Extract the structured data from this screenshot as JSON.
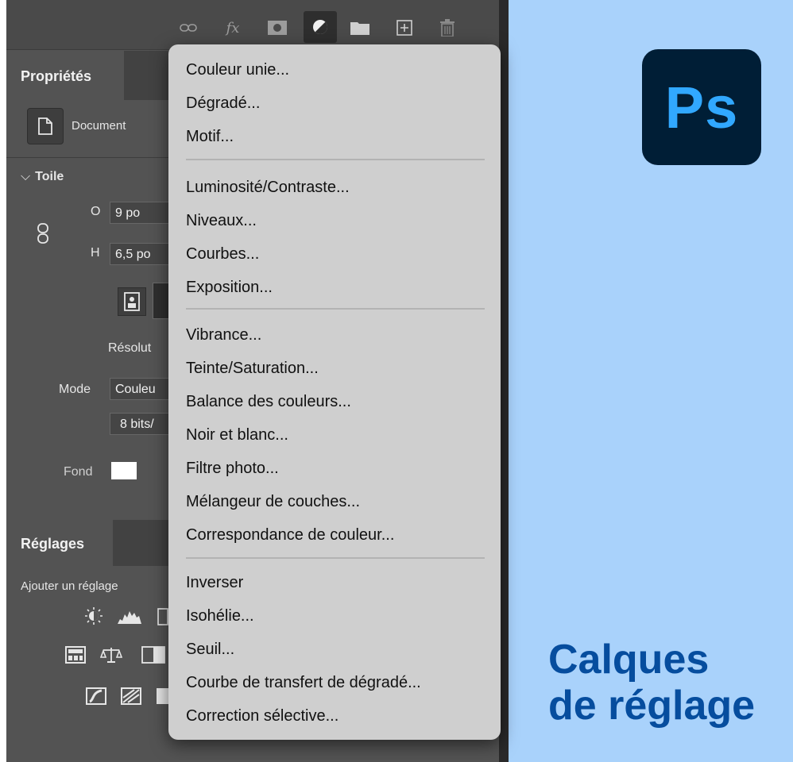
{
  "panel": {
    "tab_label": "Propriétés",
    "document_label": "Document",
    "section_title": "Toile",
    "width_label": "O",
    "width_value": "9 po",
    "height_label": "H",
    "height_value": "6,5 po",
    "resolution_label": "Résolut",
    "mode_label": "Mode",
    "mode_value": "Couleu",
    "bits_value": "8 bits/",
    "fond_label": "Fond",
    "adjustments_tab": "Réglages",
    "add_adjustment_label": "Ajouter un réglage"
  },
  "menu": {
    "group1": [
      "Couleur unie...",
      "Dégradé...",
      "Motif..."
    ],
    "group2": [
      "Luminosité/Contraste...",
      "Niveaux...",
      "Courbes...",
      "Exposition..."
    ],
    "group3": [
      "Vibrance...",
      "Teinte/Saturation...",
      "Balance des couleurs...",
      "Noir et blanc...",
      "Filtre photo...",
      "Mélangeur de couches...",
      "Correspondance de couleur..."
    ],
    "group4": [
      "Inverser",
      "Isohélie...",
      "Seuil...",
      "Courbe de transfert de dégradé...",
      "Correction sélective..."
    ]
  },
  "logo": {
    "text": "Ps"
  },
  "title": {
    "line1": "Calques",
    "line2": "de réglage"
  },
  "colors": {
    "accent_blue": "#064d9e",
    "ps_blue": "#31a8ff",
    "ps_bg": "#001e36",
    "right_bg": "#a9d2fb"
  }
}
